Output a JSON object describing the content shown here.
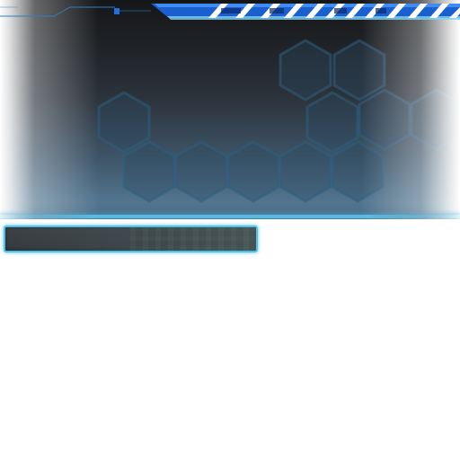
{
  "texture": {
    "background_color": "#ffffff",
    "panel_accent_color": "#1e6fe0",
    "border_glow_color": "#4cc3e6",
    "hex_stroke_color": "#2d5f80",
    "hex_fill_color": "#2a4a63"
  },
  "progress_bar": {
    "value": 1.0,
    "border_color": "#4cc3e6",
    "track_color": "#3a3f43"
  }
}
